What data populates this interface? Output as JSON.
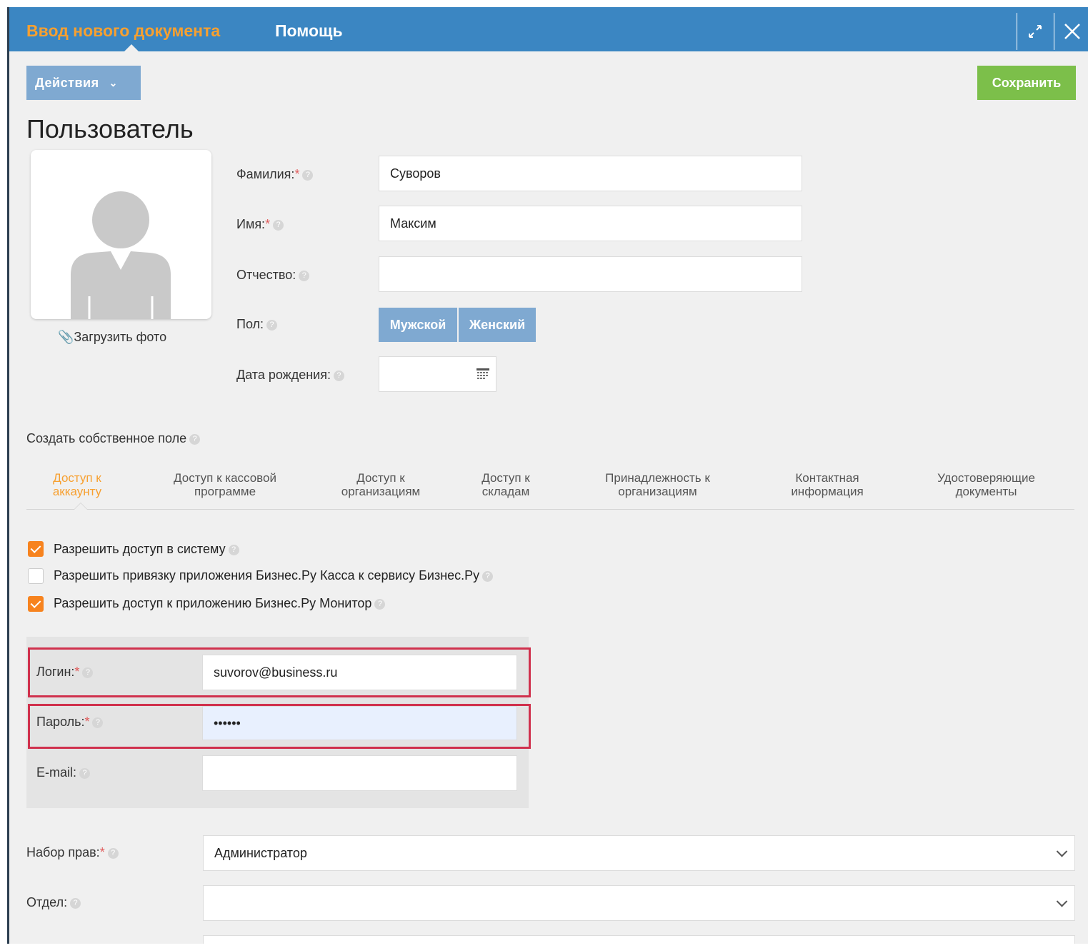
{
  "header": {
    "tab_active": "Ввод нового документа",
    "tab_help": "Помощь",
    "expand_icon": "expand-icon",
    "close_icon": "close-icon"
  },
  "toolbar": {
    "actions_label": "Действия",
    "save_label": "Сохранить"
  },
  "page_title": "Пользователь",
  "photo": {
    "upload_label": "Загрузить фото"
  },
  "fields": {
    "surname_label": "Фамилия:",
    "surname_value": "Суворов",
    "name_label": "Имя:",
    "name_value": "Максим",
    "patronymic_label": "Отчество:",
    "patronymic_value": "",
    "gender_label": "Пол:",
    "gender_male": "Мужской",
    "gender_female": "Женский",
    "birthdate_label": "Дата рождения:",
    "birthdate_value": ""
  },
  "custom_field_label": "Создать собственное поле",
  "subtabs": [
    {
      "line1": "Доступ к",
      "line2": "аккаунту"
    },
    {
      "line1": "Доступ к кассовой",
      "line2": "программе"
    },
    {
      "line1": "Доступ к",
      "line2": "организациям"
    },
    {
      "line1": "Доступ к",
      "line2": "складам"
    },
    {
      "line1": "Принадлежность к",
      "line2": "организациям"
    },
    {
      "line1": "Контактная",
      "line2": "информация"
    },
    {
      "line1": "Удостоверяющие",
      "line2": "документы"
    }
  ],
  "checkboxes": [
    {
      "label": "Разрешить доступ в систему",
      "checked": true
    },
    {
      "label": "Разрешить привязку приложения Бизнес.Ру Касса к сервису Бизнес.Ру",
      "checked": false
    },
    {
      "label": "Разрешить доступ к приложению Бизнес.Ру Монитор",
      "checked": true
    }
  ],
  "credentials": {
    "login_label": "Логин:",
    "login_value": "suvorov@business.ru",
    "password_label": "Пароль:",
    "password_value": "••••••",
    "email_label": "E-mail:",
    "email_value": ""
  },
  "rights": {
    "rights_label": "Набор прав:",
    "rights_value": "Администратор",
    "department_label": "Отдел:",
    "department_value": ""
  },
  "colors": {
    "header_bg": "#3b86c2",
    "accent_orange": "#f7a030",
    "save_green": "#7cbf4a",
    "highlight_red": "#d0314d"
  }
}
